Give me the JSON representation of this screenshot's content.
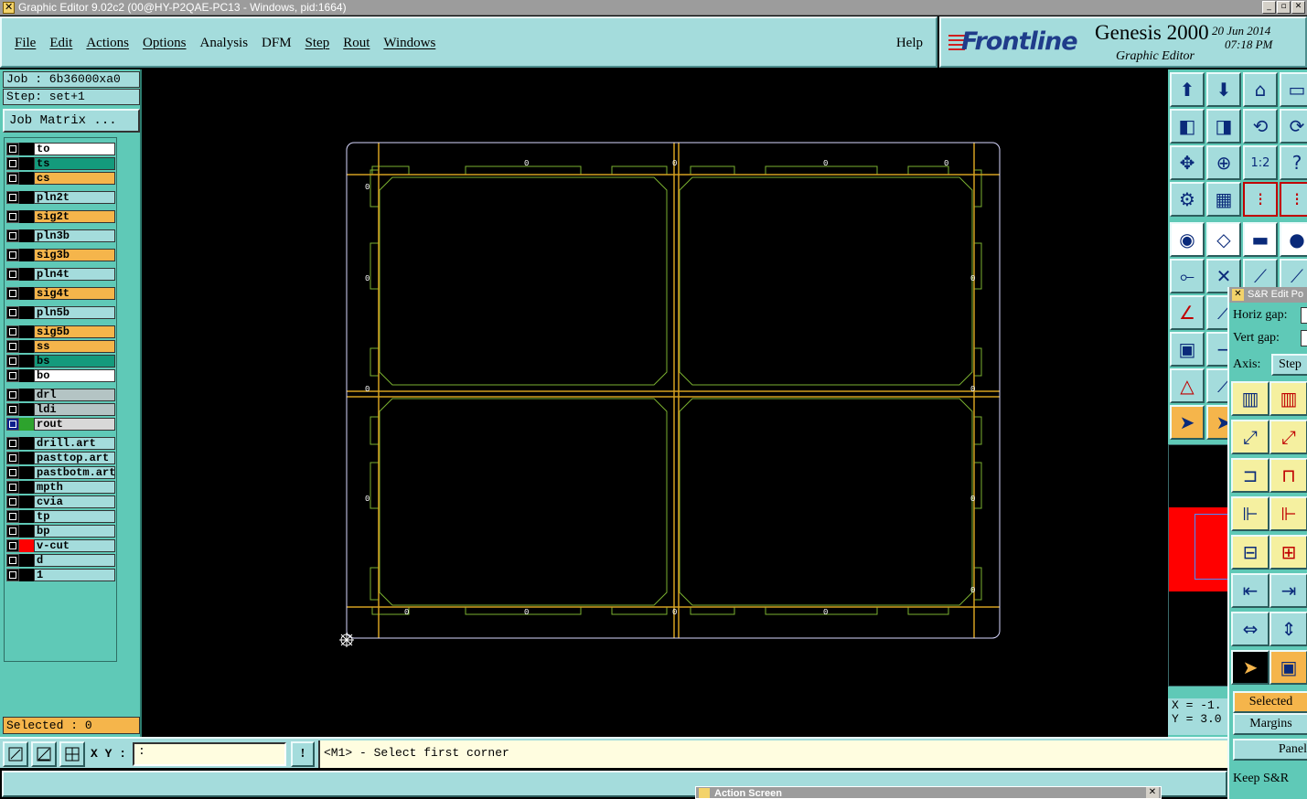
{
  "window": {
    "title": "Graphic Editor 9.02c2 (00@HY-P2QAE-PC13 - Windows, pid:1664)",
    "buttons": [
      "_",
      "▫",
      "✕"
    ]
  },
  "menu": {
    "items": [
      "File",
      "Edit",
      "Actions",
      "Options",
      "Analysis",
      "DFM",
      "Step",
      "Rout",
      "Windows"
    ],
    "help": "Help"
  },
  "brand": {
    "logo": "Frontline",
    "product": "Genesis 2000",
    "subtitle": "Graphic Editor",
    "date": "20  Jun  2014",
    "time": "07:18  PM"
  },
  "job": {
    "job_label": "Job : 6b36000xa0",
    "step_label": "Step: set+1",
    "matrix_button": "Job Matrix ..."
  },
  "layers": [
    {
      "name": "to",
      "color": "#ffffff",
      "swatch": "#000000"
    },
    {
      "name": "ts",
      "color": "#149a7c",
      "swatch": "#000000"
    },
    {
      "name": "cs",
      "color": "#f5b54b",
      "swatch": "#000000"
    },
    {
      "name": "pln2t",
      "color": "#a4dcdc",
      "swatch": "#000000"
    },
    {
      "name": "sig2t",
      "color": "#f5b54b",
      "swatch": "#000000"
    },
    {
      "name": "pln3b",
      "color": "#a4dcdc",
      "swatch": "#000000"
    },
    {
      "name": "sig3b",
      "color": "#f5b54b",
      "swatch": "#000000"
    },
    {
      "name": "pln4t",
      "color": "#a4dcdc",
      "swatch": "#000000"
    },
    {
      "name": "sig4t",
      "color": "#f5b54b",
      "swatch": "#000000"
    },
    {
      "name": "pln5b",
      "color": "#a4dcdc",
      "swatch": "#000000"
    },
    {
      "name": "sig5b",
      "color": "#f5b54b",
      "swatch": "#000000"
    },
    {
      "name": "ss",
      "color": "#f5b54b",
      "swatch": "#000000"
    },
    {
      "name": "bs",
      "color": "#149a7c",
      "swatch": "#000000"
    },
    {
      "name": "bo",
      "color": "#ffffff",
      "swatch": "#000000"
    },
    {
      "name": "drl",
      "color": "#b4c4c4",
      "swatch": "#000000"
    },
    {
      "name": "ldi",
      "color": "#b4c4c4",
      "swatch": "#000000"
    },
    {
      "name": "rout",
      "color": "#d8d8d8",
      "swatch": "#2da32d"
    },
    {
      "name": "drill.art",
      "color": "#a4dcdc",
      "swatch": "#000000"
    },
    {
      "name": "pasttop.art",
      "color": "#a4dcdc",
      "swatch": "#000000"
    },
    {
      "name": "pastbotm.art",
      "color": "#a4dcdc",
      "swatch": "#000000"
    },
    {
      "name": "mpth",
      "color": "#a4dcdc",
      "swatch": "#000000"
    },
    {
      "name": "cvia",
      "color": "#a4dcdc",
      "swatch": "#000000"
    },
    {
      "name": "tp",
      "color": "#a4dcdc",
      "swatch": "#000000"
    },
    {
      "name": "bp",
      "color": "#a4dcdc",
      "swatch": "#000000"
    },
    {
      "name": "v-cut",
      "color": "#a4dcdc",
      "swatch": "#ff0000"
    },
    {
      "name": "d",
      "color": "#a4dcdc",
      "swatch": "#000000"
    },
    {
      "name": "1",
      "color": "#a4dcdc",
      "swatch": "#000000"
    }
  ],
  "selected_label": "Selected : 0",
  "tools": {
    "rows": [
      [
        "save-icon",
        "download-icon",
        "home-icon",
        "panel-icon"
      ],
      [
        "import-icon",
        "export-icon",
        "undo-icon",
        "redo-icon"
      ],
      [
        "fit-icon",
        "center-icon",
        "one-to-two-icon",
        "help-icon"
      ],
      [
        "tools-icon",
        "grid-icon",
        "snap-red-icon",
        "snap-red2-icon"
      ],
      [
        "contour-icon",
        "measure-icon",
        "ruler-icon",
        "pad-icon"
      ],
      [
        "net-icon",
        "cross-icon",
        "line-icon",
        "line2-icon"
      ],
      [
        "angle-icon",
        "arc-icon"
      ],
      [
        "pad-shape-icon",
        "minus-icon"
      ],
      [
        "triangle-icon",
        "slope-icon"
      ],
      [
        "pointer-icon",
        "pointer-orange-icon"
      ]
    ],
    "one_to_two": "1:2",
    "question": "?"
  },
  "coords": {
    "x": "X = -1.",
    "y": "Y = 3.0"
  },
  "sr_popup": {
    "title": "S&R Edit Po",
    "horiz_gap": "Horiz gap:",
    "vert_gap": "Vert   gap:",
    "axis": "Axis:",
    "axis_value": "Step",
    "selected": "Selected",
    "margins": "Margins",
    "panel": "Panel",
    "keep": "Keep S&R"
  },
  "cmd": {
    "xy_label": "X Y :",
    "xy_value": ":",
    "info_button": "!",
    "prompt": "<M1> - Select first corner"
  },
  "action_screen": {
    "title": "Action Screen"
  },
  "canvas_labels": [
    "0",
    "0",
    "0",
    "0",
    "0",
    "0",
    "0",
    "0",
    "0",
    "0",
    "0",
    "0",
    "0",
    "0",
    "0",
    "0",
    "0",
    "0",
    "0",
    "0"
  ],
  "colors": {
    "teal": "#a4dcdc",
    "green_panel": "#5fc9b7",
    "orange": "#f5b54b",
    "profile": "#d8d8ff",
    "rout": "#d4a020",
    "green_outline": "#7ab030"
  }
}
